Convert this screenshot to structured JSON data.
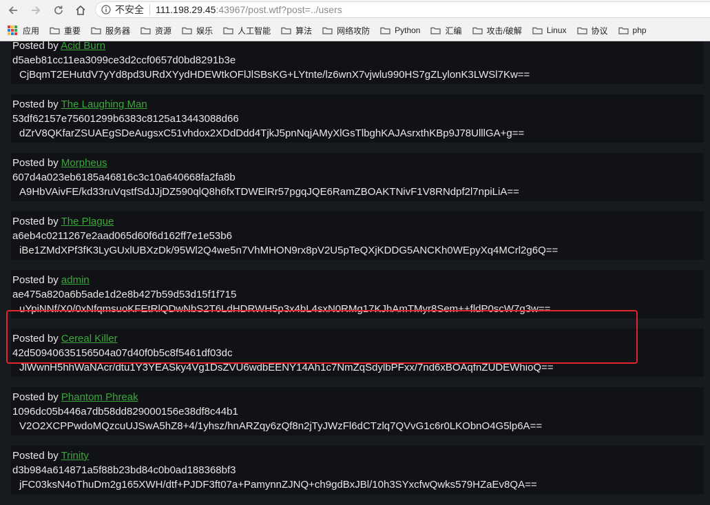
{
  "browser": {
    "security_label": "不安全",
    "url_host": "111.198.29.45",
    "url_rest": ":43967/post.wtf?post=../users",
    "bookmarks": [
      {
        "label": "应用",
        "icon": "apps-grid-icon"
      },
      {
        "label": "重要",
        "icon": "folder-icon"
      },
      {
        "label": "服务器",
        "icon": "folder-icon"
      },
      {
        "label": "资源",
        "icon": "folder-icon"
      },
      {
        "label": "娱乐",
        "icon": "folder-icon"
      },
      {
        "label": "人工智能",
        "icon": "folder-icon"
      },
      {
        "label": "算法",
        "icon": "folder-icon"
      },
      {
        "label": "网络攻防",
        "icon": "folder-icon"
      },
      {
        "label": "Python",
        "icon": "folder-icon"
      },
      {
        "label": "汇编",
        "icon": "folder-icon"
      },
      {
        "label": "攻击/破解",
        "icon": "folder-icon"
      },
      {
        "label": "Linux",
        "icon": "folder-icon"
      },
      {
        "label": "协议",
        "icon": "folder-icon"
      },
      {
        "label": "php",
        "icon": "folder-icon"
      }
    ]
  },
  "colors": {
    "page_bg": "#171b20",
    "post_bg": "#101215",
    "link": "#3aa83a",
    "highlight": "#e3262b"
  },
  "posts": [
    {
      "prefix": "Posted by",
      "author": "Acid Burn",
      "hash": "d5aeb81cc11ea3099ce3d2ccf0657d0bd8291b3e",
      "body": "CjBqmT2EHutdV7yYd8pd3URdXYydHDEWtkOFlJlSBsKG+LYtnte/lz6wnX7vjwlu990HS7gZLylonK3LWSl7Kw=="
    },
    {
      "prefix": "Posted by",
      "author": "The Laughing Man",
      "hash": "53df62157e75601299b6383c8125a13443088d66",
      "body": "dZrV8QKfarZSUAEgSDeAugsxC51vhdox2XDdDdd4TjkJ5pnNqjAMyXlGsTlbghKAJAsrxthKBp9J78UlllGA+g=="
    },
    {
      "prefix": "Posted by",
      "author": "Morpheus",
      "hash": "607d4a023eb6185a46816c3c10a640668fa2fa8b",
      "body": "A9HbVAivFE/kd33ruVqstfSdJJjDZ590qlQ8h6fxTDWElRr57pgqJQE6RamZBOAKTNivF1V8RNdpf2l7npiLiA=="
    },
    {
      "prefix": "Posted by",
      "author": "The Plague",
      "hash": "a6eb4c0211267e2aad065d60f6d162ff7e1e53b6",
      "body": "iBe1ZMdXPf3fK3LyGUxlUBXzDk/95Wl2Q4we5n7VhMHON9rx8pV2U5pTeQXjKDDG5ANCKh0WEpyXq4MCrl2g6Q=="
    },
    {
      "prefix": "Posted by",
      "author": "admin",
      "hash": "ae475a820a6b5ade1d2e8b427b59d53d15f1f715",
      "body": "uYpiNNf/X0/0xNfqmsuoKFEtRlQDwNbS2T6LdHDRWH5p3x4bL4sxN0RMg17KJhAmTMyr8Sem++fldP0scW7g3w=="
    },
    {
      "prefix": "Posted by",
      "author": "Cereal Killer",
      "hash": "42d50940635156504a07d40f0b5c8f5461df03dc",
      "body": "JlWwnH5hhWaNAcr/dtu1Y3YEASky4Vg1DsZVU6wdbEENY14Ah1c7NmZqSdylbPFxx/7nd6xBOAqfnZUDEWhioQ=="
    },
    {
      "prefix": "Posted by",
      "author": "Phantom Phreak",
      "hash": "1096dc05b446a7db58dd829000156e38df8c44b1",
      "body": "V2O2XCPPwdoMQzcuUJSwA5hZ8+4/1yhsz/hnARZqy6zQf8n2jTyJWzFl6dCTzlq7QVvG1c6r0LKObnO4G5lp6A=="
    },
    {
      "prefix": "Posted by",
      "author": "Trinity",
      "hash": "d3b984a614871a5f88b23bd84c0b0ad188368bf3",
      "body": "jFC03ksN4oThuDm2g165XWH/dtf+PJDF3ft07a+PamynnZJNQ+ch9gdBxJBl/10h3SYxcfwQwks579HZaEv8QA=="
    }
  ]
}
